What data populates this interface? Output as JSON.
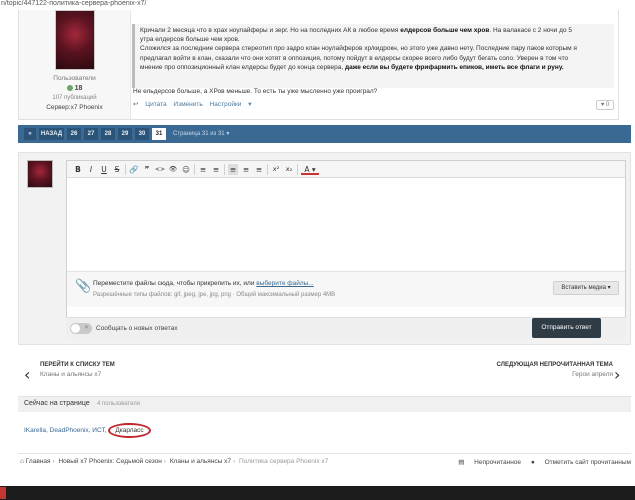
{
  "url": {
    "host": "...",
    "path": "n/topic/447122-политика-сервера-phoenix-x7/"
  },
  "post": {
    "author": {
      "group": "Пользователи",
      "reputation": "18",
      "posts": "107 публикаций",
      "server": "Сервер:x7 Phoenix"
    },
    "quote_lines": [
      [
        "Кричали 2 месяца что в храх ноулайферы и зерг. Но на последних АК в любое время ",
        "елдерсов больше чем хров",
        ". На валакасе с 2 ночи до 5"
      ],
      [
        "утра елдерсов больше чем хров.",
        "",
        ""
      ],
      [
        "Сложился за последние сервера стереотип про задро клан ноулайферов хр/кидрокн, но этого уже давно нету. Последние пару паков которым я",
        "",
        ""
      ],
      [
        "предлагал войти в клан, сказали что они хотят в оппозиция, потому пойдут в елдерсы скорее всего либо будут бегать соло. Уверен в том что",
        "",
        ""
      ],
      [
        "мнение про оппозиционный клан елдерсы будет до конца сервера, ",
        "даже если вы будете фрифармить епиков, иметь все флаги и руну.",
        ""
      ]
    ],
    "text_after": "Не ельдерсов больше, а ХРов меньше. То есть ты уже мысленно уже проиграл?",
    "actions": {
      "quote": "Цитата",
      "edit": "Изменить",
      "settings": "Настройки"
    },
    "likes": "0"
  },
  "pagination": {
    "back": "НАЗАД",
    "pages": [
      "26",
      "27",
      "28",
      "29",
      "30",
      "31"
    ],
    "current": "31",
    "info": "Страница 31 из 31"
  },
  "editor": {
    "toolbar": [
      "B",
      "I",
      "U",
      "S",
      "🔗",
      "”",
      "<>",
      "👁",
      "☺",
      "≡",
      "≡",
      "≡",
      "≡",
      "≡",
      "x²",
      "x₂",
      "A"
    ],
    "attach_text": "Переместите файлы сюда, чтобы прикрепить их, или ",
    "attach_link": "выберите файлы...",
    "allowed": "Разрешённые типы файлов: gif, jpeg, jpe, jpg, png · Общий максимальный размер 4MB",
    "insert_media": "Вставить медиа",
    "notify_label": "Сообщать о новых ответах",
    "submit": "Отправить ответ"
  },
  "navigation": {
    "prev_title": "ПЕРЕЙТИ К СПИСКУ ТЕМ",
    "prev_sub": "Кланы и альянсы x7",
    "next_title": "СЛЕДУЮЩАЯ НЕПРОЧИТАННАЯ ТЕМА",
    "next_sub": "Герои апреля"
  },
  "online": {
    "title": "Сейчас на странице",
    "count": "4 пользователя",
    "users": "IKarella, DeadPhoenix, ИСТ, ",
    "highlighted_user": "Дкарласс"
  },
  "breadcrumb": {
    "items": [
      "Главная",
      "Новый x7 Phoenix: Седьмой сезон",
      "Кланы и альянсы x7"
    ],
    "current": "Политика сервера Phoenix x7",
    "unread": "Непрочитанное",
    "mark_read": "Отметить сайт прочитанным"
  }
}
